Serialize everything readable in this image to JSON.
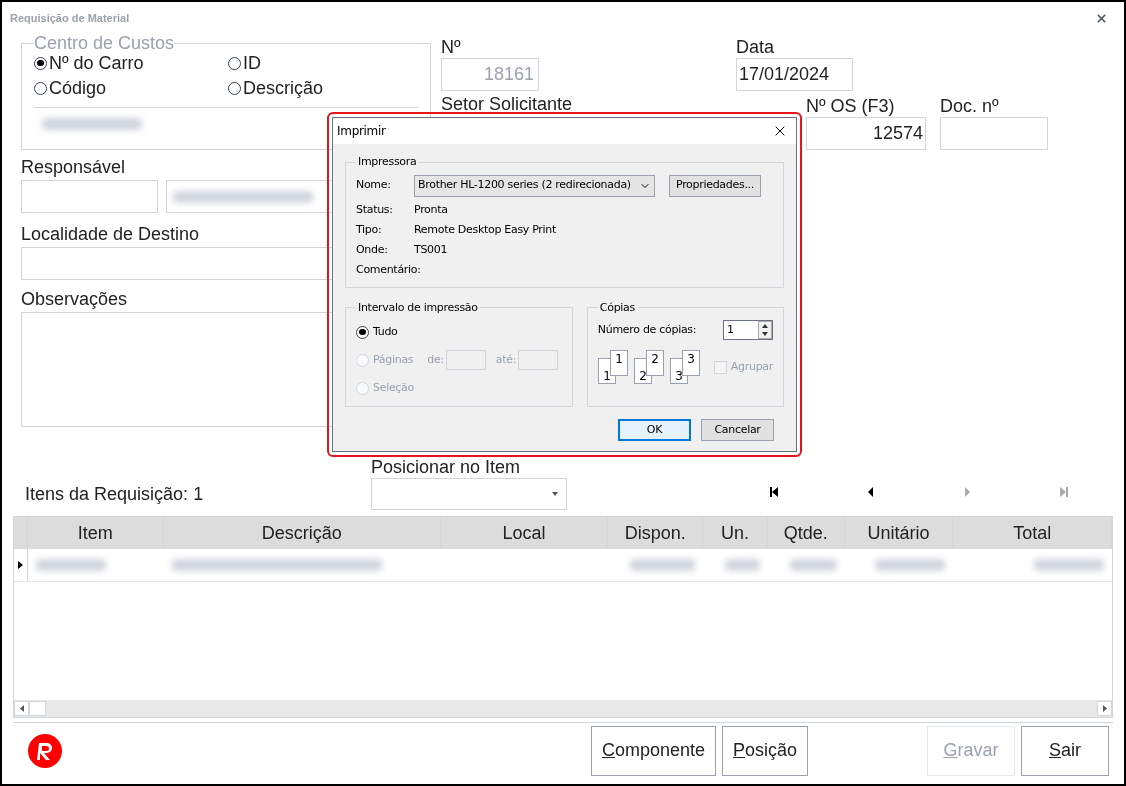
{
  "window": {
    "title": "Requisição de Material"
  },
  "cost_center": {
    "legend": "Centro de Custos",
    "options": [
      {
        "label": "Nº do Carro",
        "selected": true
      },
      {
        "label": "ID",
        "selected": false
      },
      {
        "label": "Código",
        "selected": false
      },
      {
        "label": "Descrição",
        "selected": false
      }
    ]
  },
  "numero": {
    "label": "Nº",
    "value": "18161",
    "disabled": true
  },
  "setor": {
    "label": "Setor Solicitante"
  },
  "data": {
    "label": "Data",
    "value": "17/01/2024"
  },
  "os": {
    "label": "Nº OS (F3)",
    "value": "12574"
  },
  "doc": {
    "label": "Doc. nº"
  },
  "responsavel": {
    "label": "Responsável"
  },
  "localidade": {
    "label": "Localidade de Destino"
  },
  "observacoes": {
    "label": "Observações"
  },
  "items": {
    "label": "Itens da Requisição:",
    "count": "1"
  },
  "position": {
    "label": "Posicionar no Item"
  },
  "navigator": [
    {
      "kind": "first",
      "disabled": false
    },
    {
      "kind": "prev",
      "disabled": false
    },
    {
      "kind": "next",
      "disabled": true
    },
    {
      "kind": "last",
      "disabled": true
    }
  ],
  "table": {
    "columns": [
      "Item",
      "Descrição",
      "Local",
      "Dispon.",
      "Un.",
      "Qtde.",
      "Unitário",
      "Total"
    ],
    "rows": [
      {
        "current": true
      }
    ]
  },
  "buttons": [
    {
      "label": "Componente",
      "disabled": false
    },
    {
      "label": "Posição",
      "disabled": false
    },
    {
      "label": "Gravar",
      "disabled": true
    },
    {
      "label": "Sair",
      "disabled": false
    }
  ],
  "print_dialog": {
    "title": "Imprimir",
    "printer": {
      "legend": "Impressora",
      "name_label": "Nome:",
      "name_value": "Brother HL-1200 series (2 redirecionada)",
      "properties": "Propriedades...",
      "info": [
        {
          "label": "Status:",
          "value": "Pronta"
        },
        {
          "label": "Tipo:",
          "value": "Remote Desktop Easy Print"
        },
        {
          "label": "Onde:",
          "value": "TS001"
        },
        {
          "label": "Comentário:"
        }
      ]
    },
    "range": {
      "legend": "Intervalo de impressão",
      "options": [
        {
          "label": "Tudo",
          "selected": true,
          "disabled": false
        },
        {
          "label": "Páginas",
          "selected": false,
          "disabled": true
        },
        {
          "label": "Seleção",
          "selected": false,
          "disabled": true
        }
      ],
      "from_label": "de:",
      "to_label": "até:"
    },
    "copies": {
      "legend": "Cópias",
      "count_label": "Número de cópias:",
      "count": "1",
      "pages": [
        {
          "back": "1",
          "front": "1"
        },
        {
          "back": "2",
          "front": "2"
        },
        {
          "back": "3",
          "front": "3"
        }
      ],
      "collate": {
        "label": "Agrupar",
        "checked": false,
        "disabled": true
      }
    },
    "buttons": [
      "OK",
      "Cancelar"
    ]
  }
}
